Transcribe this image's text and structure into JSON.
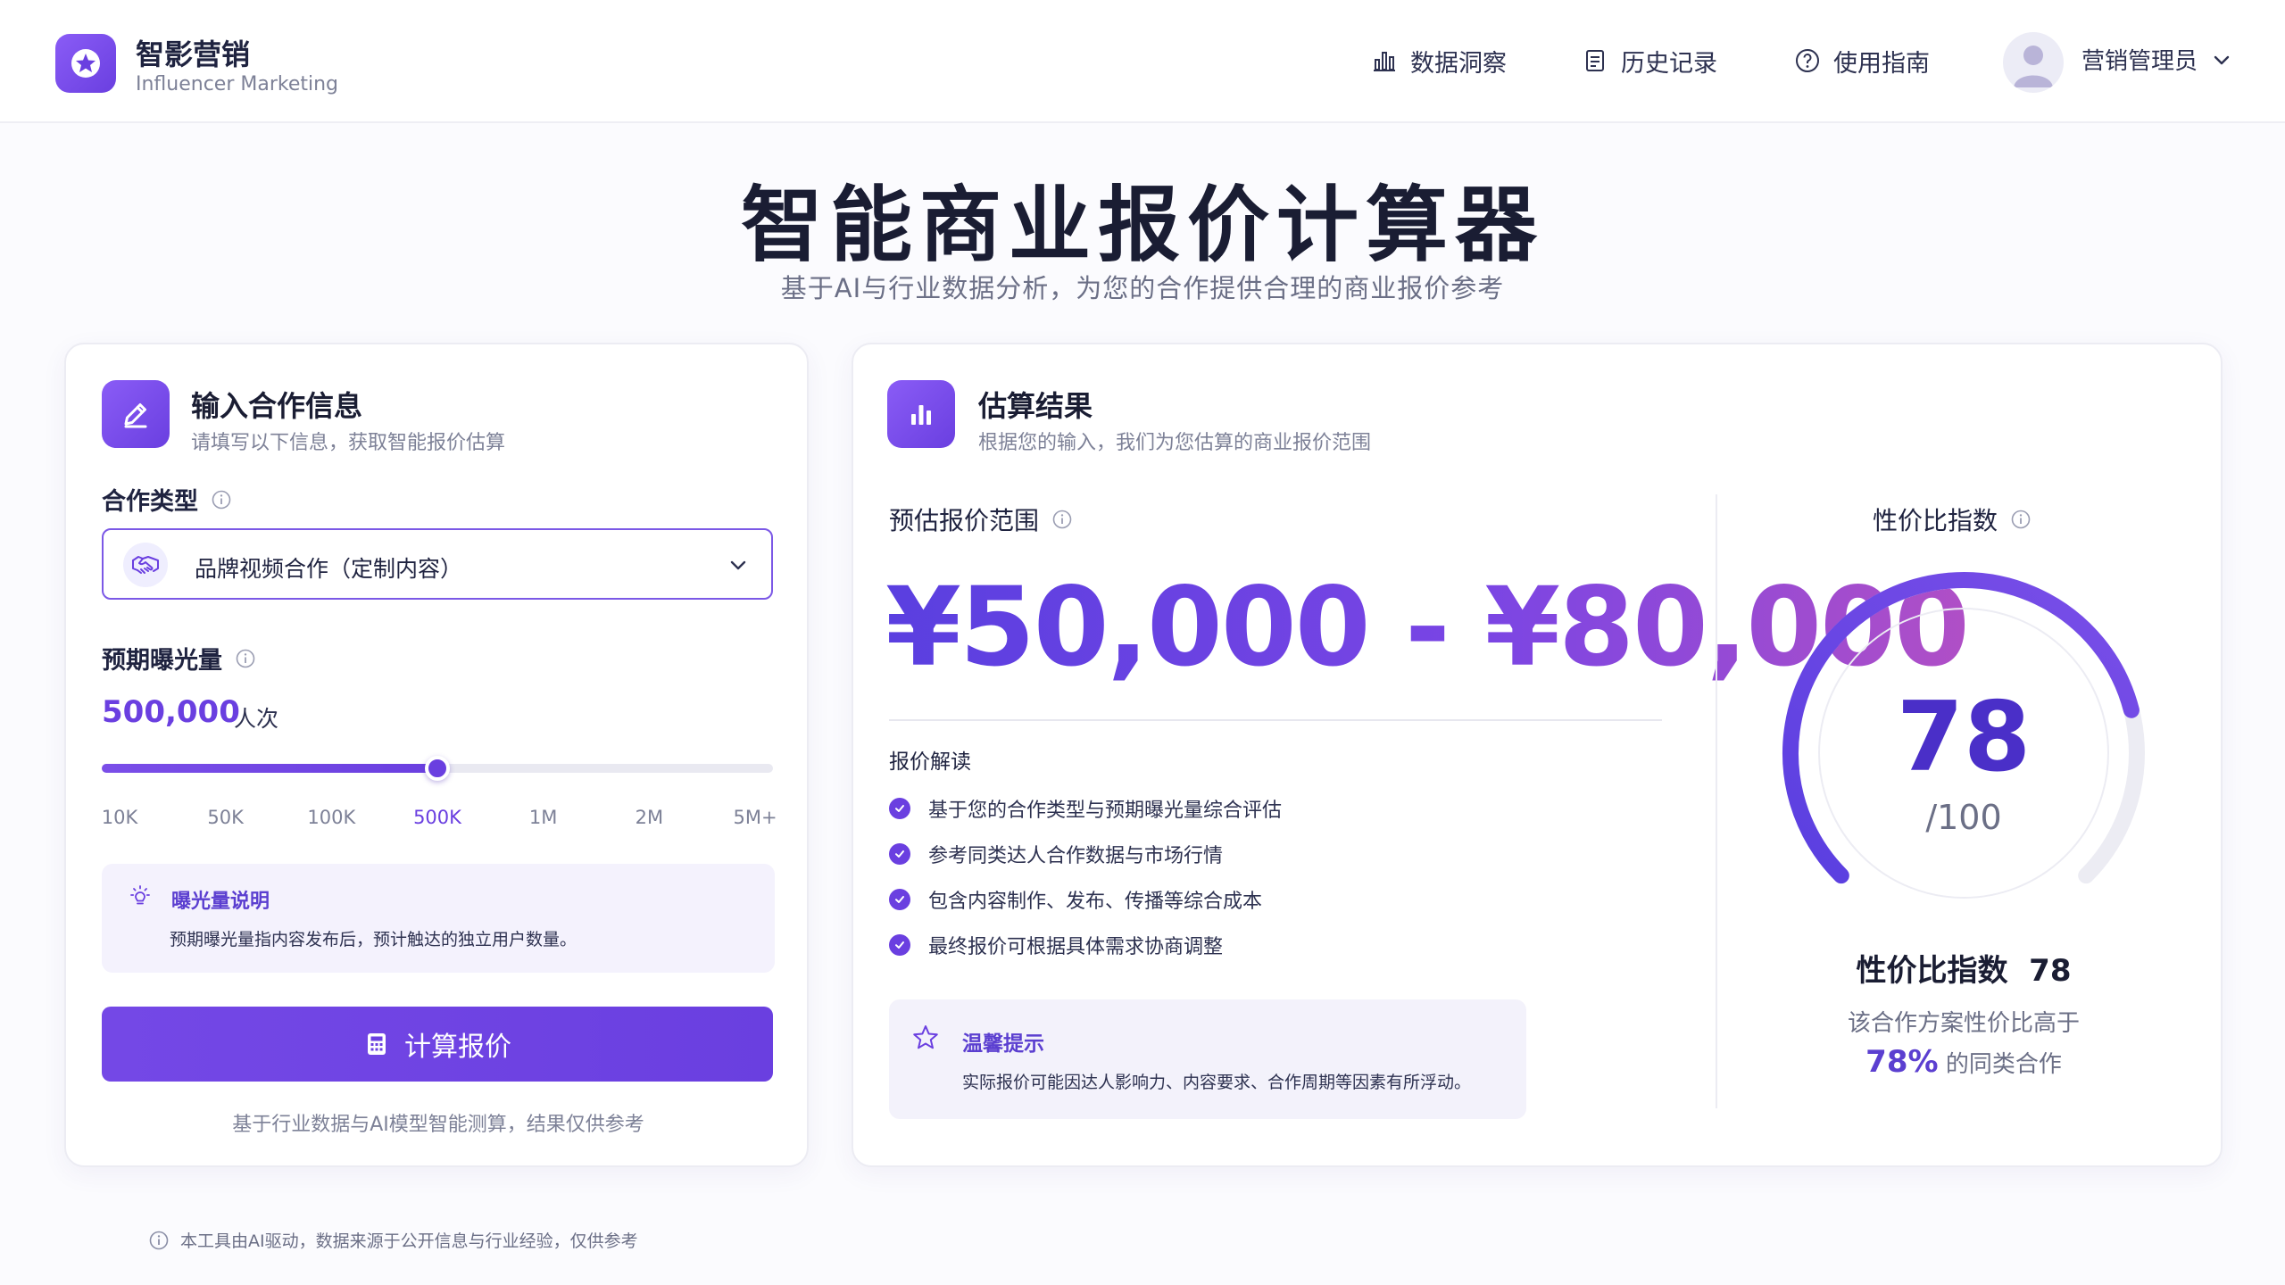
{
  "header": {
    "brand_name": "智影营销",
    "brand_sub": "Influencer Marketing",
    "nav": [
      {
        "label": "数据洞察",
        "icon": "bar-chart-icon"
      },
      {
        "label": "历史记录",
        "icon": "document-icon"
      },
      {
        "label": "使用指南",
        "icon": "help-circle-icon"
      }
    ],
    "user_name": "营销管理员"
  },
  "page": {
    "title": "智能商业报价计算器",
    "subtitle": "基于AI与行业数据分析，为您的合作提供合理的商业报价参考"
  },
  "input_card": {
    "title": "输入合作信息",
    "subtitle": "请填写以下信息，获取智能报价估算",
    "coop_type_label": "合作类型",
    "coop_type_value": "品牌视频合作（定制内容）",
    "exposure_label": "预期曝光量",
    "exposure_value": "500,000",
    "exposure_unit": "人次",
    "slider": {
      "ticks": [
        "10K",
        "50K",
        "100K",
        "500K",
        "1M",
        "2M",
        "5M+"
      ],
      "active_index": 3
    },
    "note_title": "曝光量说明",
    "note_text": "预期曝光量指内容发布后，预计触达的独立用户数量。",
    "button_label": "计算报价",
    "footnote": "基于行业数据与AI模型智能测算，结果仅供参考"
  },
  "result_card": {
    "title": "估算结果",
    "subtitle": "根据您的输入，我们为您估算的商业报价范围",
    "range_label": "预估报价范围",
    "range_value": "¥50,000 - ¥80,000",
    "explain_title": "报价解读",
    "explain_items": [
      "基于您的合作类型与预期曝光量综合评估",
      "参考同类达人合作数据与市场行情",
      "包含内容制作、发布、传播等综合成本",
      "最终报价可根据具体需求协商调整"
    ],
    "tip_title": "温馨提示",
    "tip_text": "实际报价可能因达人影响力、内容要求、合作周期等因素有所浮动。",
    "gauge": {
      "label": "性价比指数",
      "score": 78,
      "score_text": "78",
      "max_text": "/100",
      "caption": "性价比指数  78",
      "desc_line1": "该合作方案性价比高于",
      "desc_pct": "78%",
      "desc_line2_suffix": " 的同类合作"
    }
  },
  "footer": {
    "note": "本工具由AI驱动，数据来源于公开信息与行业经验，仅供参考"
  },
  "colors": {
    "accent": "#6a3fe0",
    "accent_light": "#8a5cf6",
    "gradient_end": "#b04fc6",
    "text_dark": "#1a1d33",
    "text_muted": "#7d8197"
  }
}
